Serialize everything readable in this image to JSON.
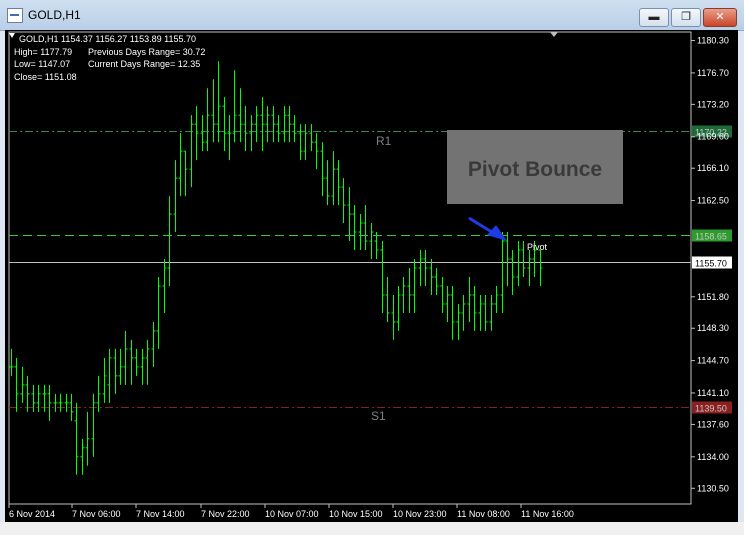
{
  "window": {
    "title": "GOLD,H1",
    "minimize": "▬",
    "maximize": "❐",
    "close": "✕"
  },
  "info": {
    "symbol_line": "GOLD,H1  1154.37 1156.27 1153.89 1155.70",
    "high": "High= 1177.79",
    "prev_range": "Previous Days Range= 30.72",
    "low": "Low= 1147.07",
    "curr_range": "Current Days Range= 12.35",
    "close": "Close= 1151.08"
  },
  "annotation": {
    "box_text": "Pivot Bounce",
    "pivot_label": "Pivot"
  },
  "colors": {
    "bull": "#00ff00",
    "bear": "#00ff00",
    "r1": "#2e8b57",
    "pivot": "#32cd32",
    "s1": "#8b2020",
    "price": "#c0c0c0",
    "arrow": "#1f3be6"
  },
  "chart_data": {
    "type": "bar",
    "title": "GOLD,H1",
    "ylim": [
      1128.75,
      1181.25
    ],
    "y_ticks": [
      "1180.30",
      "1176.70",
      "1173.20",
      "1169.60",
      "1166.10",
      "1162.50",
      "1151.80",
      "1148.30",
      "1144.70",
      "1141.10",
      "1137.60",
      "1134.00",
      "1130.50"
    ],
    "x_ticks": [
      "6 Nov 2014",
      "7 Nov 06:00",
      "7 Nov 14:00",
      "7 Nov 22:00",
      "10 Nov 07:00",
      "10 Nov 15:00",
      "10 Nov 23:00",
      "11 Nov 08:00",
      "11 Nov 16:00"
    ],
    "lines": [
      {
        "name": "R1",
        "value": 1170.22,
        "style": "dashdot"
      },
      {
        "name": "Pivot",
        "value": 1158.65,
        "style": "dash"
      },
      {
        "name": "Price",
        "value": 1155.7,
        "style": "solid"
      },
      {
        "name": "S1",
        "value": 1139.5,
        "style": "dashdot"
      }
    ],
    "ohlc": [
      [
        1144,
        1146,
        1143,
        1144
      ],
      [
        1144,
        1145,
        1139,
        1141
      ],
      [
        1141,
        1144,
        1140,
        1142
      ],
      [
        1142,
        1143,
        1139,
        1141
      ],
      [
        1141,
        1142,
        1139,
        1140
      ],
      [
        1140,
        1142,
        1139,
        1141
      ],
      [
        1141,
        1142,
        1139,
        1141
      ],
      [
        1141,
        1142,
        1138,
        1140
      ],
      [
        1140,
        1141,
        1139,
        1140
      ],
      [
        1140,
        1141,
        1139,
        1140
      ],
      [
        1140,
        1141,
        1139,
        1140
      ],
      [
        1140,
        1141,
        1138,
        1139
      ],
      [
        1138,
        1140,
        1132,
        1134
      ],
      [
        1134,
        1136,
        1132,
        1135
      ],
      [
        1135,
        1139,
        1133,
        1136
      ],
      [
        1136,
        1141,
        1134,
        1140
      ],
      [
        1140,
        1143,
        1139,
        1141
      ],
      [
        1141,
        1145,
        1140,
        1143
      ],
      [
        1142,
        1146,
        1140,
        1145
      ],
      [
        1145,
        1146,
        1141,
        1143
      ],
      [
        1143,
        1146,
        1142,
        1144
      ],
      [
        1144,
        1148,
        1142,
        1146
      ],
      [
        1146,
        1147,
        1142,
        1145
      ],
      [
        1145,
        1146,
        1143,
        1144
      ],
      [
        1144,
        1146,
        1142,
        1145
      ],
      [
        1145,
        1147,
        1142,
        1146
      ],
      [
        1146,
        1149,
        1144,
        1148
      ],
      [
        1148,
        1154,
        1146,
        1153
      ],
      [
        1153,
        1156,
        1150,
        1155
      ],
      [
        1155,
        1163,
        1153,
        1161
      ],
      [
        1161,
        1167,
        1159,
        1165
      ],
      [
        1165,
        1170,
        1163,
        1168
      ],
      [
        1168,
        1168,
        1163,
        1166
      ],
      [
        1166,
        1172,
        1164,
        1171
      ],
      [
        1171,
        1173,
        1167,
        1170
      ],
      [
        1170,
        1172,
        1168,
        1169
      ],
      [
        1169,
        1175,
        1168,
        1172
      ],
      [
        1172,
        1176,
        1169,
        1171
      ],
      [
        1171,
        1178,
        1169,
        1173
      ],
      [
        1173,
        1174,
        1168,
        1170
      ],
      [
        1170,
        1172,
        1167,
        1170
      ],
      [
        1170,
        1177,
        1169,
        1172
      ],
      [
        1172,
        1175,
        1169,
        1171
      ],
      [
        1171,
        1173,
        1168,
        1170
      ],
      [
        1170,
        1172,
        1168,
        1171
      ],
      [
        1171,
        1173,
        1169,
        1172
      ],
      [
        1172,
        1174,
        1168,
        1171
      ],
      [
        1171,
        1173,
        1169,
        1172
      ],
      [
        1172,
        1173,
        1169,
        1171
      ],
      [
        1171,
        1172,
        1169,
        1170
      ],
      [
        1170,
        1173,
        1169,
        1172
      ],
      [
        1172,
        1173,
        1169,
        1171
      ],
      [
        1171,
        1172,
        1169,
        1170
      ],
      [
        1170,
        1171,
        1167,
        1168
      ],
      [
        1168,
        1171,
        1167,
        1170
      ],
      [
        1170,
        1171,
        1168,
        1169
      ],
      [
        1169,
        1170,
        1166,
        1168
      ],
      [
        1168,
        1169,
        1163,
        1165
      ],
      [
        1165,
        1167,
        1162,
        1163
      ],
      [
        1163,
        1168,
        1162,
        1166
      ],
      [
        1166,
        1167,
        1162,
        1164
      ],
      [
        1164,
        1165,
        1160,
        1162
      ],
      [
        1162,
        1164,
        1158,
        1161
      ],
      [
        1161,
        1162,
        1157,
        1159
      ],
      [
        1159,
        1161,
        1157,
        1160
      ],
      [
        1160,
        1162,
        1157,
        1158
      ],
      [
        1158,
        1160,
        1156,
        1159
      ],
      [
        1158,
        1159,
        1156,
        1157
      ],
      [
        1157,
        1158,
        1150,
        1152
      ],
      [
        1152,
        1154,
        1149,
        1150
      ],
      [
        1150,
        1152,
        1147,
        1149
      ],
      [
        1149,
        1153,
        1148,
        1152
      ],
      [
        1152,
        1154,
        1150,
        1153
      ],
      [
        1153,
        1155,
        1150,
        1152
      ],
      [
        1152,
        1156,
        1150,
        1155
      ],
      [
        1155,
        1157,
        1153,
        1156
      ],
      [
        1156,
        1157,
        1153,
        1155
      ],
      [
        1155,
        1156,
        1152,
        1154
      ],
      [
        1154,
        1155,
        1152,
        1153
      ],
      [
        1153,
        1154,
        1150,
        1151
      ],
      [
        1151,
        1153,
        1149,
        1152
      ],
      [
        1152,
        1153,
        1147,
        1149
      ],
      [
        1149,
        1151,
        1147,
        1150
      ],
      [
        1150,
        1152,
        1148,
        1151
      ],
      [
        1151,
        1154,
        1149,
        1152
      ],
      [
        1152,
        1153,
        1148,
        1150
      ],
      [
        1150,
        1152,
        1148,
        1151
      ],
      [
        1151,
        1152,
        1148,
        1149
      ],
      [
        1149,
        1152,
        1148,
        1151
      ],
      [
        1151,
        1153,
        1150,
        1152
      ],
      [
        1152,
        1159,
        1150,
        1158
      ],
      [
        1158,
        1159,
        1153,
        1156
      ],
      [
        1156,
        1157,
        1152,
        1154
      ],
      [
        1154,
        1158,
        1153,
        1157
      ],
      [
        1157,
        1158,
        1154,
        1155
      ],
      [
        1155,
        1157,
        1153,
        1156
      ],
      [
        1156,
        1158,
        1154,
        1157
      ],
      [
        1157,
        1157,
        1153,
        1155
      ]
    ]
  }
}
